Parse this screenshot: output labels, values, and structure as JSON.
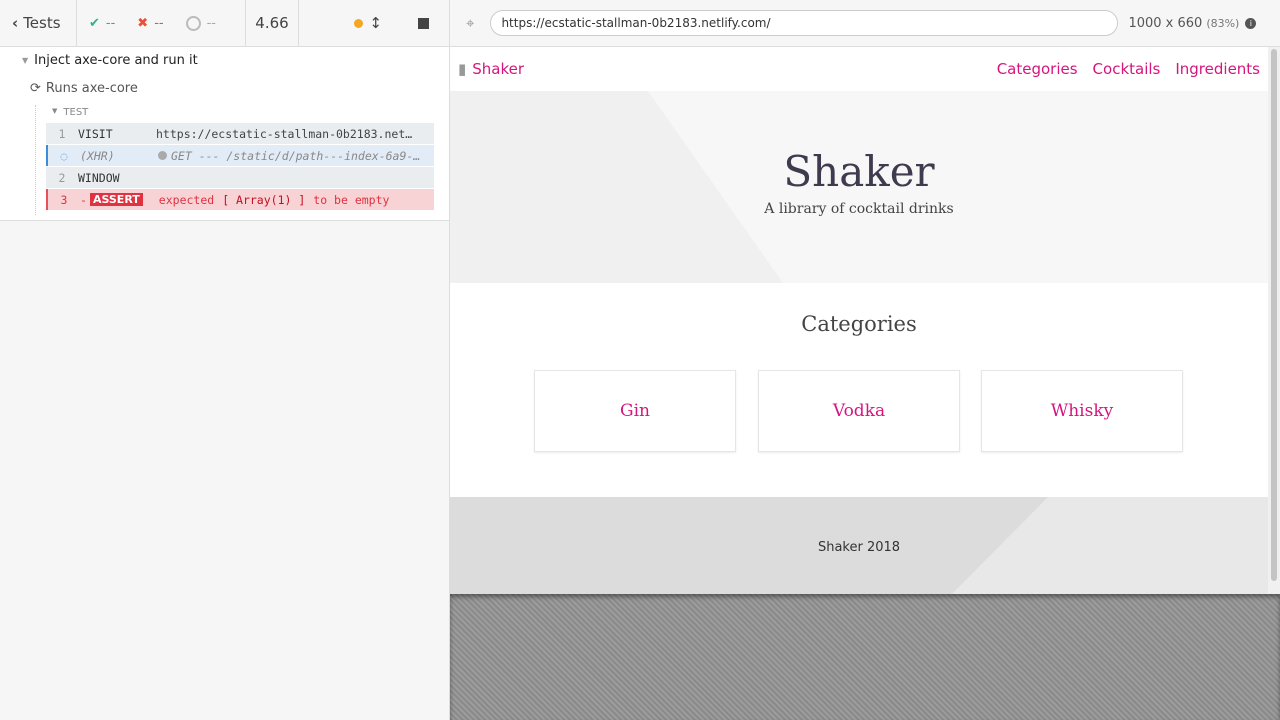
{
  "runner": {
    "back_label": "Tests",
    "passed": "--",
    "failed": "--",
    "pending": "--",
    "duration": "4.66"
  },
  "suite": {
    "title": "Inject axe-core and run it",
    "test_title": "Runs axe-core",
    "section": "TEST",
    "commands": [
      {
        "num": "1",
        "name": "VISIT",
        "message": "https://ecstatic-stallman-0b2183.net…"
      },
      {
        "num": "",
        "name": "(XHR)",
        "message": "GET --- /static/d/path---index-6a9-…"
      },
      {
        "num": "2",
        "name": "WINDOW",
        "message": ""
      },
      {
        "num": "3",
        "name": "ASSERT",
        "message_pre": "expected",
        "message_mid": "[ Array(1) ]",
        "message_post": "to be empty"
      }
    ]
  },
  "browser": {
    "url": "https://ecstatic-stallman-0b2183.netlify.com/",
    "viewport": "1000 x 660",
    "scale": "(83%)"
  },
  "site": {
    "brand": "Shaker",
    "nav": [
      "Categories",
      "Cocktails",
      "Ingredients"
    ],
    "hero_title": "Shaker",
    "hero_subtitle": "A library of cocktail drinks",
    "section_title": "Categories",
    "categories": [
      "Gin",
      "Vodka",
      "Whisky"
    ],
    "footer": "Shaker 2018"
  }
}
